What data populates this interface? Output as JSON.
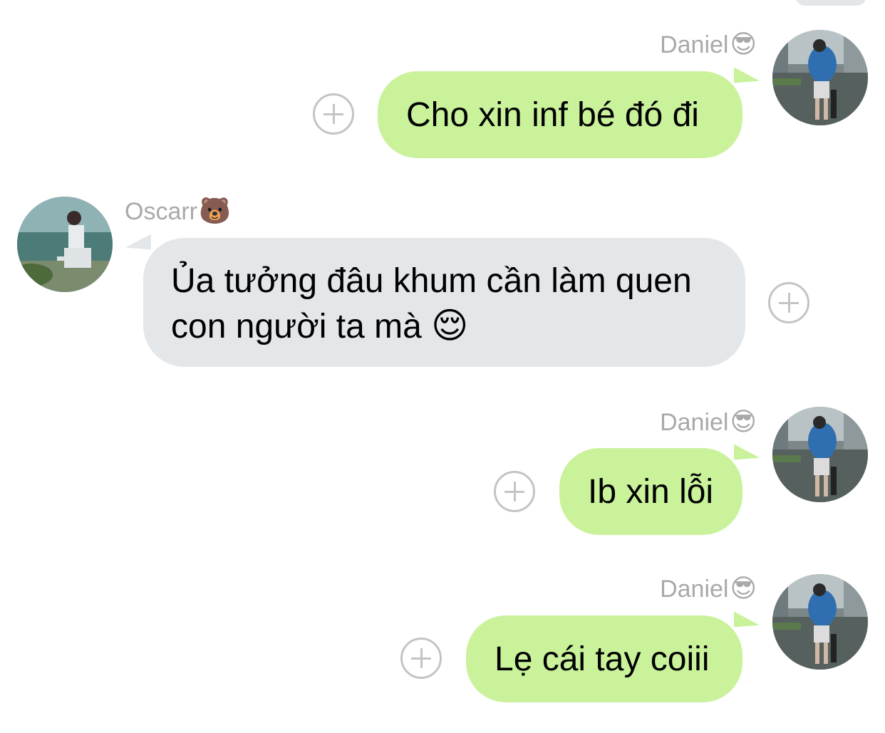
{
  "messages": [
    {
      "sender": "Daniel",
      "sender_emoji": "😎",
      "text": "Cho xin inf bé đó đi",
      "direction": "outgoing"
    },
    {
      "sender": "Oscarr",
      "sender_emoji": "🐻",
      "text_line1": "Ủa tưởng đâu khum cần làm quen",
      "text_line2": "con người ta mà",
      "text_emoji": "😌",
      "direction": "incoming"
    },
    {
      "sender": "Daniel",
      "sender_emoji": "😎",
      "text": "Ib xin lỗi",
      "direction": "outgoing"
    },
    {
      "sender": "Daniel",
      "sender_emoji": "😎",
      "text": "Lẹ cái tay coiii",
      "direction": "outgoing"
    }
  ],
  "colors": {
    "outgoing_bubble": "#c9f29b",
    "incoming_bubble": "#e4e7ea",
    "sender_name": "#a9a9a9",
    "add_icon": "#c4c4c4"
  },
  "icons": {
    "add_reaction": "plus-circle-icon"
  }
}
